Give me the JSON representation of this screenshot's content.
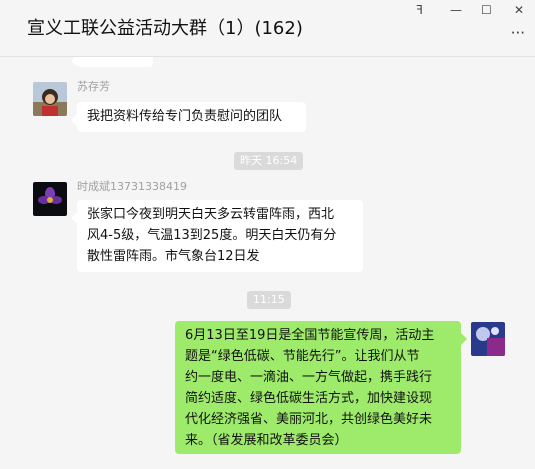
{
  "window": {
    "title": "宣义工联公益活动大群（1）(162)",
    "controls": {
      "pin": "ꟻ",
      "minimize": "—",
      "maximize": "☐",
      "close": "✕"
    },
    "more_icon": "···"
  },
  "messages": [
    {
      "sender": "苏存芳",
      "text": "我把资料传给专门负责慰问的团队"
    },
    {
      "time_divider": "昨天 16:54"
    },
    {
      "sender": "时成斌13731338419",
      "lines": [
        "张家口今夜到明天白天多云转雷阵雨，西北",
        "风4-5级，气温13到25度。明天白天仍有分",
        "散性雷阵雨。市气象台12日发"
      ]
    },
    {
      "time_divider": "11:15"
    },
    {
      "sender": "me",
      "lines": [
        "6月13日至19日是全国节能宣传周，活动主",
        "题是“绿色低碳、节能先行”。让我们从节",
        "约一度电、一滴油、一方气做起，携手践行",
        "简约适度、绿色低碳生活方式，加快建设现",
        "代化经济强省、美丽河北，共创绿色美好未",
        "来。（省发展和改革委员会）"
      ]
    }
  ],
  "colors": {
    "self_bubble": "#9eea6a",
    "other_bubble": "#ffffff",
    "background": "#f5f5f5"
  }
}
